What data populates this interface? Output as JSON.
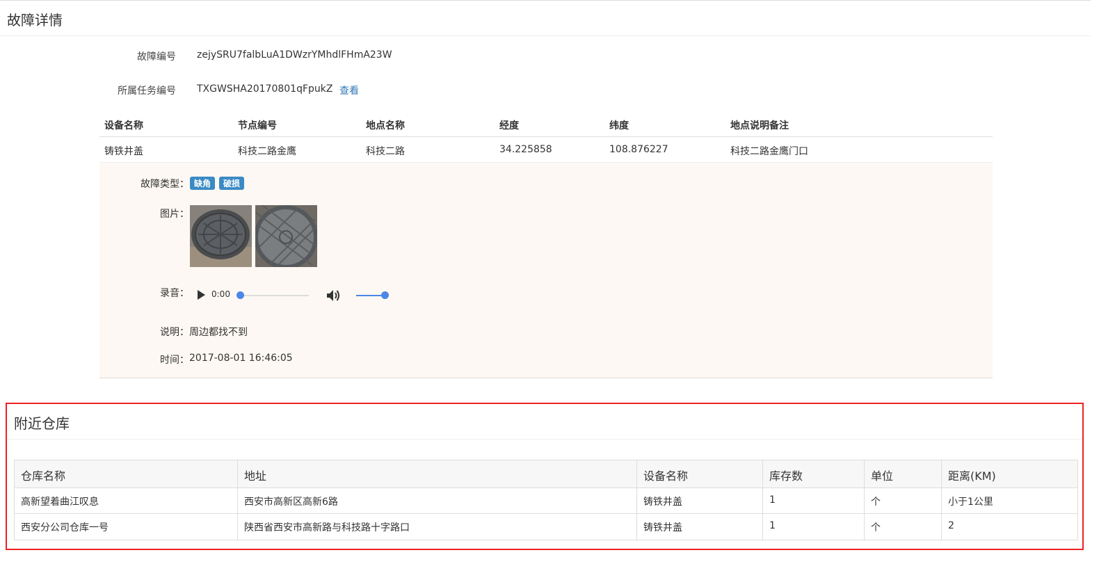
{
  "header": {
    "title": "故障详情"
  },
  "fault": {
    "id_label": "故障编号",
    "id_value": "zejySRU7falbLuA1DWzrYMhdlFHmA23W",
    "task_label": "所属任务编号",
    "task_value": "TXGWSHA20170801qFpukZ",
    "task_link": "查看"
  },
  "device_table": {
    "headers": [
      "设备名称",
      "节点编号",
      "地点名称",
      "经度",
      "纬度",
      "地点说明备注"
    ],
    "rows": [
      [
        "铸铁井盖",
        "科技二路金鹰",
        "科技二路",
        "34.225858",
        "108.876227",
        "科技二路金鹰门口"
      ]
    ]
  },
  "detail": {
    "type_label": "故障类型：",
    "tags": [
      "缺角",
      "破损"
    ],
    "photo_label": "图片：",
    "audio_label": "录音：",
    "audio_time": "0:00",
    "audio_progress": 0,
    "audio_volume": 1,
    "desc_label": "说明：",
    "desc_value": "周边都找不到",
    "time_label": "时间：",
    "time_value": "2017-08-01 16:46:05"
  },
  "warehouses": {
    "title": "附近仓库",
    "headers": [
      "仓库名称",
      "地址",
      "设备名称",
      "库存数",
      "单位",
      "距离(KM)"
    ],
    "rows": [
      [
        "高新望着曲江叹息",
        "西安市高新区高新6路",
        "铸铁井盖",
        "1",
        "个",
        "小于1公里"
      ],
      [
        "西安分公司仓库一号",
        "陕西省西安市高新路与科技路十字路口",
        "铸铁井盖",
        "1",
        "个",
        "2"
      ]
    ]
  },
  "icons": {
    "play": "play-icon",
    "volume": "volume-icon"
  },
  "colors": {
    "tag_bg": "#3a8ac4",
    "link": "#337ab7",
    "detail_bg": "#fdf8f3",
    "highlight_border": "#e22222",
    "audio_accent": "#4c87e8"
  }
}
